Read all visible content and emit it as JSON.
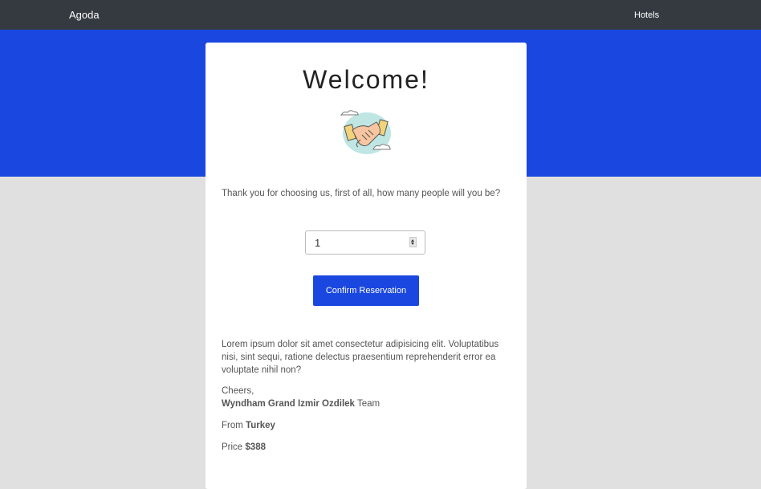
{
  "navbar": {
    "brand": "Agoda",
    "links": [
      "Hotels"
    ]
  },
  "card": {
    "title": "Welcome!",
    "question": "Thank you for choosing us, first of all, how many people will you be?",
    "people_input_value": "1",
    "confirm_label": "Confirm Reservation",
    "lorem": "Lorem ipsum dolor sit amet consectetur adipisicing elit. Voluptatibus nisi, sint sequi, ratione delectus praesentium reprehenderit error ea voluptate nihil non?",
    "cheers": "Cheers,",
    "hotel_name": "Wyndham Grand Izmir Ozdilek",
    "team_suffix": "Team",
    "from_label": "From",
    "country": "Turkey",
    "price_label": "Price",
    "price": "$388"
  },
  "icons": {
    "illustration": "handshake-icon"
  },
  "colors": {
    "navbar": "#343a40",
    "accent": "#1a47e0",
    "page_bg": "#e0e0e0"
  }
}
